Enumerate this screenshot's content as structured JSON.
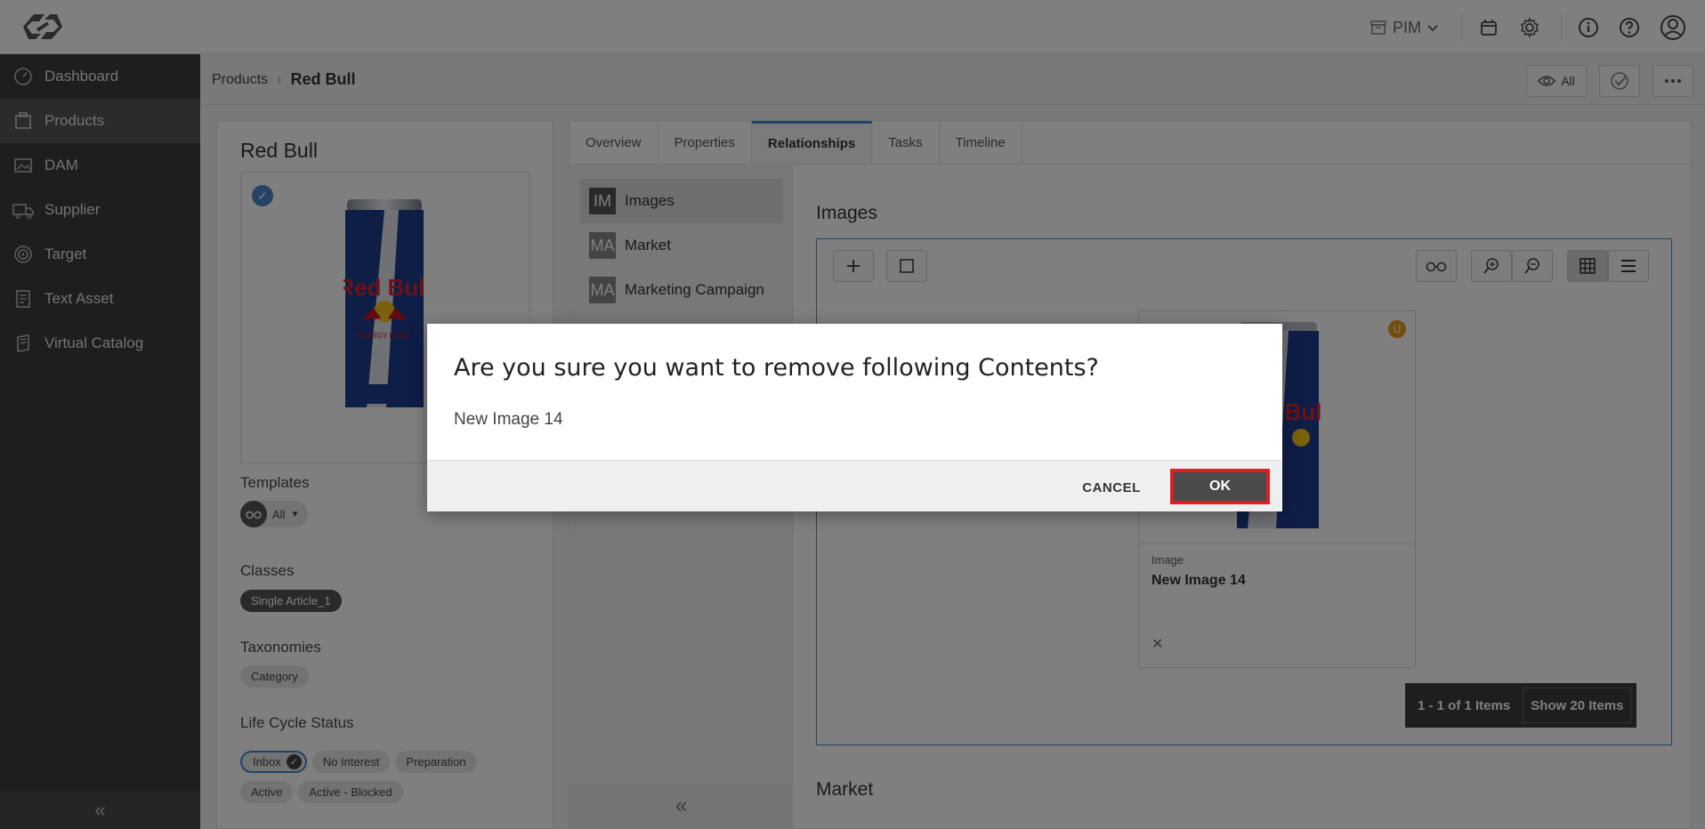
{
  "topbar": {
    "workspace_label": "PIM"
  },
  "sidebar": {
    "items": [
      {
        "label": "Dashboard",
        "icon": "dashboard-icon"
      },
      {
        "label": "Products",
        "icon": "products-icon"
      },
      {
        "label": "DAM",
        "icon": "image-icon"
      },
      {
        "label": "Supplier",
        "icon": "truck-icon"
      },
      {
        "label": "Target",
        "icon": "target-icon"
      },
      {
        "label": "Text Asset",
        "icon": "document-icon"
      },
      {
        "label": "Virtual Catalog",
        "icon": "catalog-icon"
      }
    ],
    "active_index": 1
  },
  "header": {
    "breadcrumb_root": "Products",
    "breadcrumb_separator": "›",
    "breadcrumb_current": "Red Bull",
    "view_label": "All"
  },
  "product": {
    "title": "Red Bull",
    "templates_label": "Templates",
    "templates_value": "All",
    "classes_label": "Classes",
    "classes": [
      "Single Article_1"
    ],
    "taxonomies_label": "Taxonomies",
    "taxonomies": [
      "Category"
    ],
    "lifecycle_label": "Life Cycle Status",
    "lifecycle_statuses": [
      "Inbox",
      "No Interest",
      "Preparation",
      "Active",
      "Active - Blocked"
    ]
  },
  "tabs": [
    "Overview",
    "Properties",
    "Relationships",
    "Tasks",
    "Timeline"
  ],
  "active_tab": "Relationships",
  "relationships": [
    {
      "abbr": "IM",
      "label": "Images"
    },
    {
      "abbr": "MA",
      "label": "Market"
    },
    {
      "abbr": "MA",
      "label": "Marketing Campaign"
    }
  ],
  "images_section": {
    "title": "Images",
    "card": {
      "badge": "U",
      "type": "Image",
      "name": "New Image 14",
      "close": "✕"
    },
    "pager": {
      "range": "1 - 1 of 1 Items",
      "show": "Show 20 Items"
    }
  },
  "market_section": {
    "title": "Market"
  },
  "dialog": {
    "title": "Are you sure you want to remove following Contents?",
    "body": "New Image 14",
    "cancel_label": "CANCEL",
    "ok_label": "OK"
  },
  "colors": {
    "sidebar_bg": "#3c3c3c",
    "accent_blue": "#4b86c8",
    "ok_highlight": "#e01c24",
    "badge_orange": "#e29a1c"
  }
}
